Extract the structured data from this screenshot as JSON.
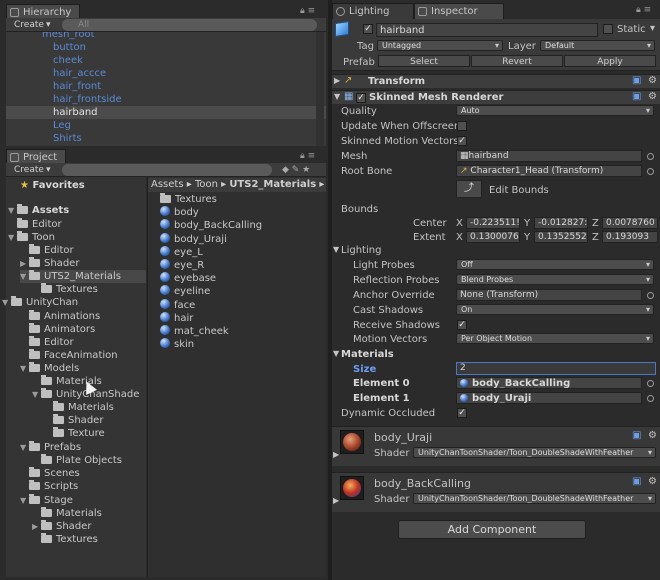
{
  "hierarchy": {
    "tab": "Hierarchy",
    "create": "Create",
    "search": "All",
    "items": [
      "mesh_root",
      "button",
      "cheek",
      "hair_accce",
      "hair_front",
      "hair_frontside",
      "hairband",
      "Leg",
      "Shirts"
    ],
    "selected": "hairband"
  },
  "project": {
    "tab": "Project",
    "create": "Create",
    "favorites": "Favorites",
    "assets": "Assets",
    "tree": [
      {
        "label": "Editor"
      },
      {
        "label": "Toon"
      },
      {
        "label": "Editor"
      },
      {
        "label": "Shader"
      },
      {
        "label": "UTS2_Materials"
      },
      {
        "label": "Textures"
      },
      {
        "label": "UnityChan"
      },
      {
        "label": "Animations"
      },
      {
        "label": "Animators"
      },
      {
        "label": "Editor"
      },
      {
        "label": "FaceAnimation"
      },
      {
        "label": "Models"
      },
      {
        "label": "Materials"
      },
      {
        "label": "UnityChanShade"
      },
      {
        "label": "Materials"
      },
      {
        "label": "Shader"
      },
      {
        "label": "Texture"
      },
      {
        "label": "Prefabs"
      },
      {
        "label": "Plate Objects"
      },
      {
        "label": "Scenes"
      },
      {
        "label": "Scripts"
      },
      {
        "label": "Stage"
      },
      {
        "label": "Materials"
      },
      {
        "label": "Shader"
      },
      {
        "label": "Textures"
      }
    ],
    "breadcrumb": [
      "Assets",
      "Toon",
      "UTS2_Materials"
    ],
    "files": [
      "Textures",
      "body",
      "body_BackCalling",
      "body_Uraji",
      "eye_L",
      "eye_R",
      "eyebase",
      "eyeline",
      "face",
      "hair",
      "mat_cheek",
      "skin"
    ]
  },
  "tabs": {
    "lighting": "Lighting",
    "inspector": "Inspector"
  },
  "inspector": {
    "object_name": "hairband",
    "static_label": "Static",
    "tag_label": "Tag",
    "tag_value": "Untagged",
    "layer_label": "Layer",
    "layer_value": "Default",
    "prefab_label": "Prefab",
    "prefab_select": "Select",
    "prefab_revert": "Revert",
    "prefab_apply": "Apply",
    "transform_title": "Transform",
    "smr_title": "Skinned Mesh Renderer",
    "quality_label": "Quality",
    "quality_value": "Auto",
    "update_offscreen": "Update When Offscreen",
    "skinned_motion": "Skinned Motion Vectors",
    "mesh_label": "Mesh",
    "mesh_value": "hairband",
    "root_bone_label": "Root Bone",
    "root_bone_value": "Character1_Head (Transform)",
    "edit_bounds": "Edit Bounds",
    "bounds_label": "Bounds",
    "center_label": "Center",
    "center_x": "-0.223511!",
    "center_y": "-0.012827:",
    "center_z": "0.0078760",
    "extent_label": "Extent",
    "extent_x": "0.1300076",
    "extent_y": "0.1352552",
    "extent_z": "0.193093",
    "x": "X",
    "y": "Y",
    "z": "Z",
    "lighting_label": "Lighting",
    "light_probes_label": "Light Probes",
    "light_probes_value": "Off",
    "reflection_label": "Reflection Probes",
    "reflection_value": "Blend Probes",
    "anchor_label": "Anchor Override",
    "anchor_value": "None (Transform)",
    "cast_label": "Cast Shadows",
    "cast_value": "On",
    "receive_label": "Receive Shadows",
    "motion_label": "Motion Vectors",
    "motion_value": "Per Object Motion",
    "materials_label": "Materials",
    "size_label": "Size",
    "size_value": "2",
    "el0_label": "Element 0",
    "el0_value": "body_BackCalling",
    "el1_label": "Element 1",
    "el1_value": "body_Uraji",
    "dynamic_label": "Dynamic Occluded",
    "mat1_name": "body_Uraji",
    "mat2_name": "body_BackCalling",
    "shader_label": "Shader",
    "shader_value": "UnityChanToonShader/Toon_DoubleShadeWithFeather",
    "add_component": "Add Component"
  }
}
